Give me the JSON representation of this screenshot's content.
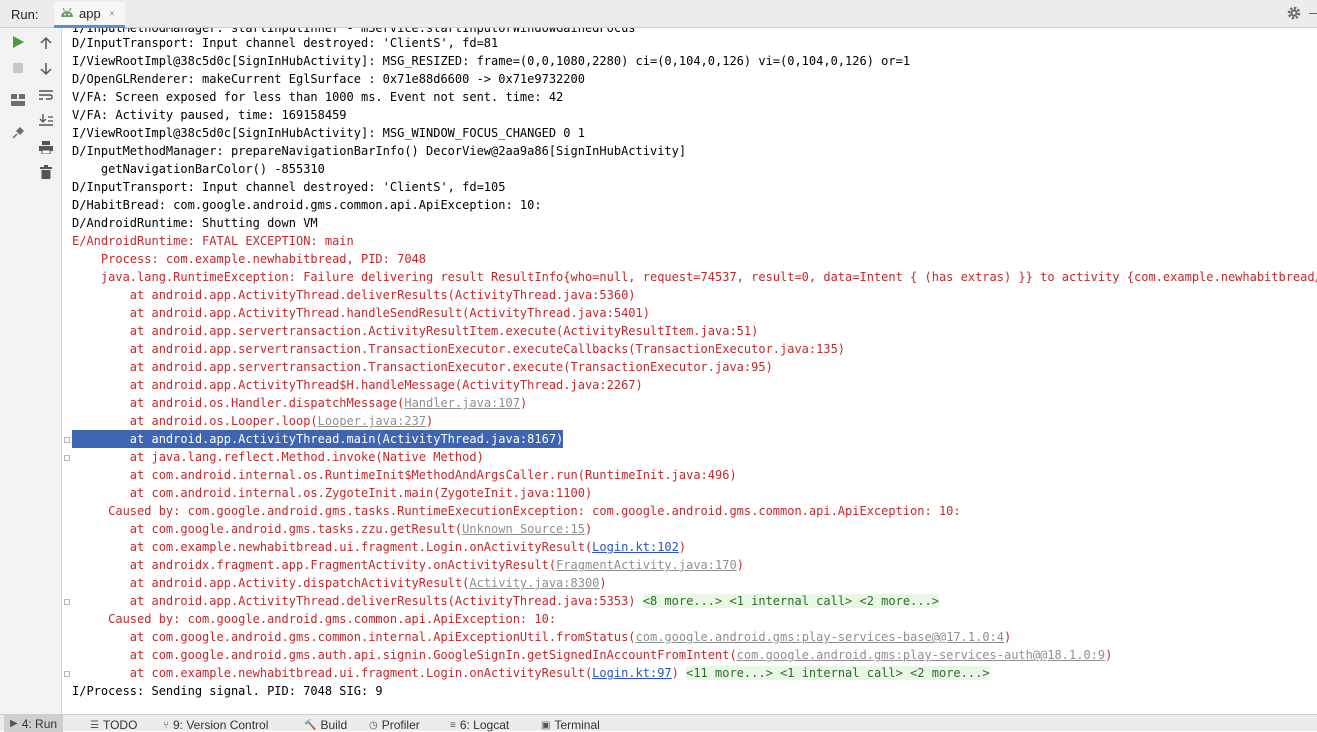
{
  "header": {
    "run_label": "Run:",
    "tab_label": "app",
    "tab_close": "×"
  },
  "colors": {
    "error_text": "#c4282a",
    "selection_bg": "#3e64b3",
    "link_blue": "#2a52c9",
    "fold_more_bg": "#eaf6e6",
    "fold_more_text": "#2d6e2d",
    "run_green": "#4a9c3c"
  },
  "toolbar_icons": [
    "rerun-icon",
    "stop-icon",
    "layout-icon",
    "pin-icon",
    "up-arrow-icon",
    "down-arrow-icon",
    "soft-wrap-icon",
    "scroll-to-end-icon",
    "print-icon",
    "trash-icon"
  ],
  "console": {
    "top_partial": "I/InputMethodManager: startInputInner - mService.startInputOrWindowGainedFocus",
    "lines": [
      {
        "text": "D/InputTransport: Input channel destroyed: 'ClientS', fd=81",
        "kind": "normal"
      },
      {
        "text": "I/ViewRootImpl@38c5d0c[SignInHubActivity]: MSG_RESIZED: frame=(0,0,1080,2280) ci=(0,104,0,126) vi=(0,104,0,126) or=1",
        "kind": "normal"
      },
      {
        "text": "D/OpenGLRenderer: makeCurrent EglSurface : 0x71e88d6600 -> 0x71e9732200",
        "kind": "normal"
      },
      {
        "text": "V/FA: Screen exposed for less than 1000 ms. Event not sent. time: 42",
        "kind": "normal"
      },
      {
        "text": "V/FA: Activity paused, time: 169158459",
        "kind": "normal"
      },
      {
        "text": "I/ViewRootImpl@38c5d0c[SignInHubActivity]: MSG_WINDOW_FOCUS_CHANGED 0 1",
        "kind": "normal"
      },
      {
        "text": "D/InputMethodManager: prepareNavigationBarInfo() DecorView@2aa9a86[SignInHubActivity]",
        "kind": "normal"
      },
      {
        "text": "    getNavigationBarColor() -855310",
        "kind": "normal"
      },
      {
        "text": "D/InputTransport: Input channel destroyed: 'ClientS', fd=105",
        "kind": "normal"
      },
      {
        "text": "D/HabitBread: com.google.android.gms.common.api.ApiException: 10:",
        "kind": "normal"
      },
      {
        "text": "D/AndroidRuntime: Shutting down VM",
        "kind": "normal"
      },
      {
        "text": "E/AndroidRuntime: FATAL EXCEPTION: main",
        "kind": "err"
      },
      {
        "text": "    Process: com.example.newhabitbread, PID: 7048",
        "kind": "err"
      },
      {
        "text": "    java.lang.RuntimeException: Failure delivering result ResultInfo{who=null, request=74537, result=0, data=Intent { (has extras) }} to activity {com.example.newhabitbread/com.example.newhabitbread.MainActivity}",
        "kind": "err"
      },
      {
        "text": "        at android.app.ActivityThread.deliverResults(ActivityThread.java:5360)",
        "kind": "err"
      },
      {
        "text": "        at android.app.ActivityThread.handleSendResult(ActivityThread.java:5401)",
        "kind": "err"
      },
      {
        "text": "        at android.app.servertransaction.ActivityResultItem.execute(ActivityResultItem.java:51)",
        "kind": "err"
      },
      {
        "text": "        at android.app.servertransaction.TransactionExecutor.executeCallbacks(TransactionExecutor.java:135)",
        "kind": "err"
      },
      {
        "text": "        at android.app.servertransaction.TransactionExecutor.execute(TransactionExecutor.java:95)",
        "kind": "err"
      },
      {
        "text": "        at android.app.ActivityThread$H.handleMessage(ActivityThread.java:2267)",
        "kind": "err"
      },
      {
        "text": "        at android.os.Handler.dispatchMessage(",
        "kind": "err",
        "link": "Handler.java:107",
        "link_style": "gray",
        "suffix": ")"
      },
      {
        "text": "        at android.os.Looper.loop(",
        "kind": "err",
        "link": "Looper.java:237",
        "link_style": "gray",
        "suffix": ")"
      },
      {
        "text": "        at android.app.ActivityThread.main(ActivityThread.java:8167)",
        "kind": "sel"
      },
      {
        "text": "        at java.lang.reflect.Method.invoke(Native Method)",
        "kind": "err"
      },
      {
        "text": "        at com.android.internal.os.RuntimeInit$MethodAndArgsCaller.run(RuntimeInit.java:496)",
        "kind": "err"
      },
      {
        "text": "        at com.android.internal.os.ZygoteInit.main(ZygoteInit.java:1100)",
        "kind": "err"
      },
      {
        "text": "     Caused by: com.google.android.gms.tasks.RuntimeExecutionException: com.google.android.gms.common.api.ApiException: 10:",
        "kind": "err"
      },
      {
        "text": "        at com.google.android.gms.tasks.zzu.getResult(",
        "kind": "err",
        "link": "Unknown Source:15",
        "link_style": "gray",
        "suffix": ")"
      },
      {
        "text": "        at com.example.newhabitbread.ui.fragment.Login.onActivityResult(",
        "kind": "err",
        "link": "Login.kt:102",
        "link_style": "blue",
        "suffix": ")"
      },
      {
        "text": "        at androidx.fragment.app.FragmentActivity.onActivityResult(",
        "kind": "err",
        "link": "FragmentActivity.java:170",
        "link_style": "gray",
        "suffix": ")"
      },
      {
        "text": "        at android.app.Activity.dispatchActivityResult(",
        "kind": "err",
        "link": "Activity.java:8300",
        "link_style": "gray",
        "suffix": ")"
      },
      {
        "text": "        at android.app.ActivityThread.deliverResults(ActivityThread.java:5353) ",
        "kind": "err",
        "more": "<8 more...> <1 internal call> <2 more...>"
      },
      {
        "text": "     Caused by: com.google.android.gms.common.api.ApiException: 10:",
        "kind": "err"
      },
      {
        "text": "        at com.google.android.gms.common.internal.ApiExceptionUtil.fromStatus(",
        "kind": "err",
        "link": "com.google.android.gms:play-services-base@@17.1.0:4",
        "link_style": "gray",
        "suffix": ")"
      },
      {
        "text": "        at com.google.android.gms.auth.api.signin.GoogleSignIn.getSignedInAccountFromIntent(",
        "kind": "err",
        "link": "com.google.android.gms:play-services-auth@@18.1.0:9",
        "link_style": "gray",
        "suffix": ")"
      },
      {
        "text": "        at com.example.newhabitbread.ui.fragment.Login.onActivityResult(",
        "kind": "err",
        "link": "Login.kt:97",
        "link_style": "blue",
        "suffix": ") ",
        "more": "<11 more...> <1 internal call> <2 more...>"
      },
      {
        "text": "I/Process: Sending signal. PID: 7048 SIG: 9",
        "kind": "normal"
      }
    ]
  },
  "bottom_tabs": [
    {
      "icon": "▶",
      "label": "4: Run",
      "active": true
    },
    {
      "icon": "☰",
      "label": "TODO",
      "active": false
    },
    {
      "icon": "⑂",
      "label": "9: Version Control",
      "active": false
    },
    {
      "icon": "🔨",
      "label": "Build",
      "active": false
    },
    {
      "icon": "◷",
      "label": "Profiler",
      "active": false
    },
    {
      "icon": "≡",
      "label": "6: Logcat",
      "active": false
    },
    {
      "icon": "▣",
      "label": "Terminal",
      "active": false
    }
  ]
}
